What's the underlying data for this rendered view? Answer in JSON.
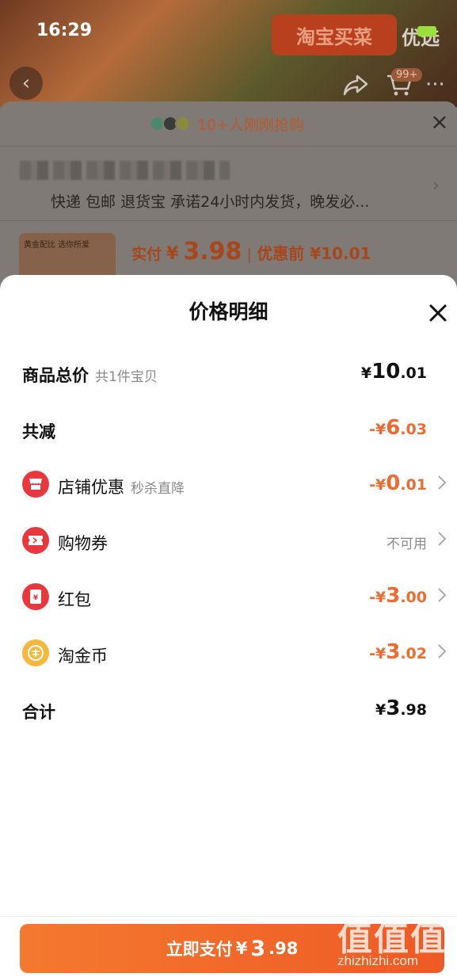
{
  "status_bar": {
    "time": "16:29"
  },
  "product_page": {
    "hero_badge": "淘宝买菜",
    "hero_badge_2": "优选",
    "cart_count": "99+",
    "more_icon": "···",
    "buyers_text": "10+人刚刚抢购",
    "shipping_text": "快递 包邮 退货宝 承诺24小时内发货，晚发必...",
    "thumb_label": "黄金配比 选你所爱",
    "price_label": "实付",
    "price_currency": "¥",
    "price_value": "3.98",
    "price_separator": "|",
    "price_before": "优惠前 ¥10.01"
  },
  "sheet": {
    "title": "价格明细",
    "rows": {
      "total": {
        "label": "商品总价",
        "sub": "共1件宝贝",
        "cur": "¥",
        "int": "10",
        "dec": ".01"
      },
      "reduce": {
        "label": "共减",
        "cur": "-¥",
        "int": "6",
        "dec": ".03"
      },
      "shop": {
        "label": "店铺优惠",
        "sub": "秒杀直降",
        "cur": "-¥",
        "int": "0",
        "dec": ".01",
        "icon": "shop-icon"
      },
      "coupon": {
        "label": "购物券",
        "status": "不可用",
        "icon": "coupon-icon"
      },
      "redpacket": {
        "label": "红包",
        "cur": "-¥",
        "int": "3",
        "dec": ".00",
        "icon": "red-packet-icon"
      },
      "coin": {
        "label": "淘金币",
        "cur": "-¥",
        "int": "3",
        "dec": ".02",
        "icon": "taojinbi-coin-icon"
      },
      "sum": {
        "label": "合计",
        "cur": "¥",
        "int": "3",
        "dec": ".98"
      }
    },
    "pay_button": {
      "label": "立即支付",
      "cur": "¥",
      "int": "3",
      "dec": ".98"
    }
  },
  "watermark": {
    "big": "值值值",
    "small": "zhizhizhi.com"
  },
  "colors": {
    "accent": "#ee6a2f",
    "pay_button": "#f26a2a",
    "icon_red": "#e8383d",
    "icon_gold": "#f5b73c"
  }
}
